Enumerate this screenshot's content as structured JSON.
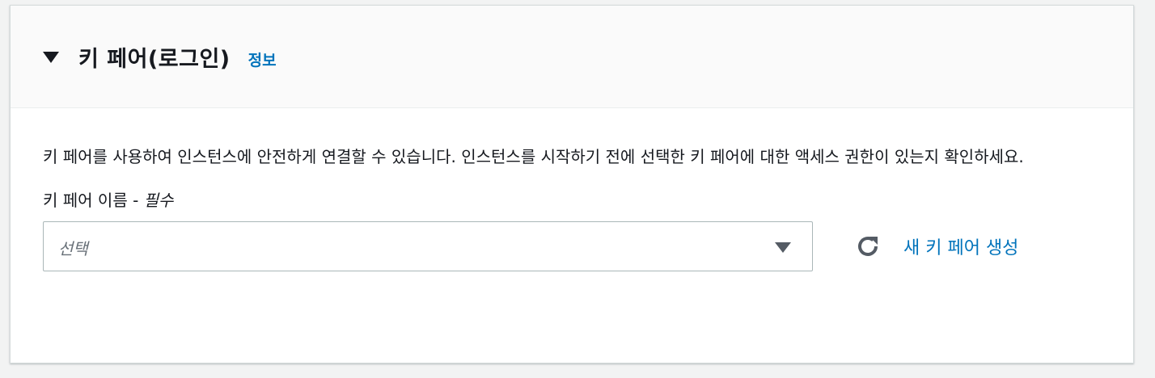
{
  "section": {
    "title": "키 페어(로그인)",
    "info_link": "정보",
    "description": "키 페어를 사용하여 인스턴스에 안전하게 연결할 수 있습니다. 인스턴스를 시작하기 전에 선택한 키 페어에 대한 액세스 권한이 있는지 확인하세요."
  },
  "key_pair_field": {
    "label": "키 페어 이름 - ",
    "required_label": "필수",
    "placeholder": "선택",
    "create_link": "새 키 페어 생성"
  },
  "icons": {
    "collapse": "caret-down-icon",
    "dropdown": "dropdown-arrow-icon",
    "refresh": "refresh-icon"
  },
  "colors": {
    "link": "#0073bb",
    "text": "#16191f",
    "placeholder": "#687078"
  }
}
